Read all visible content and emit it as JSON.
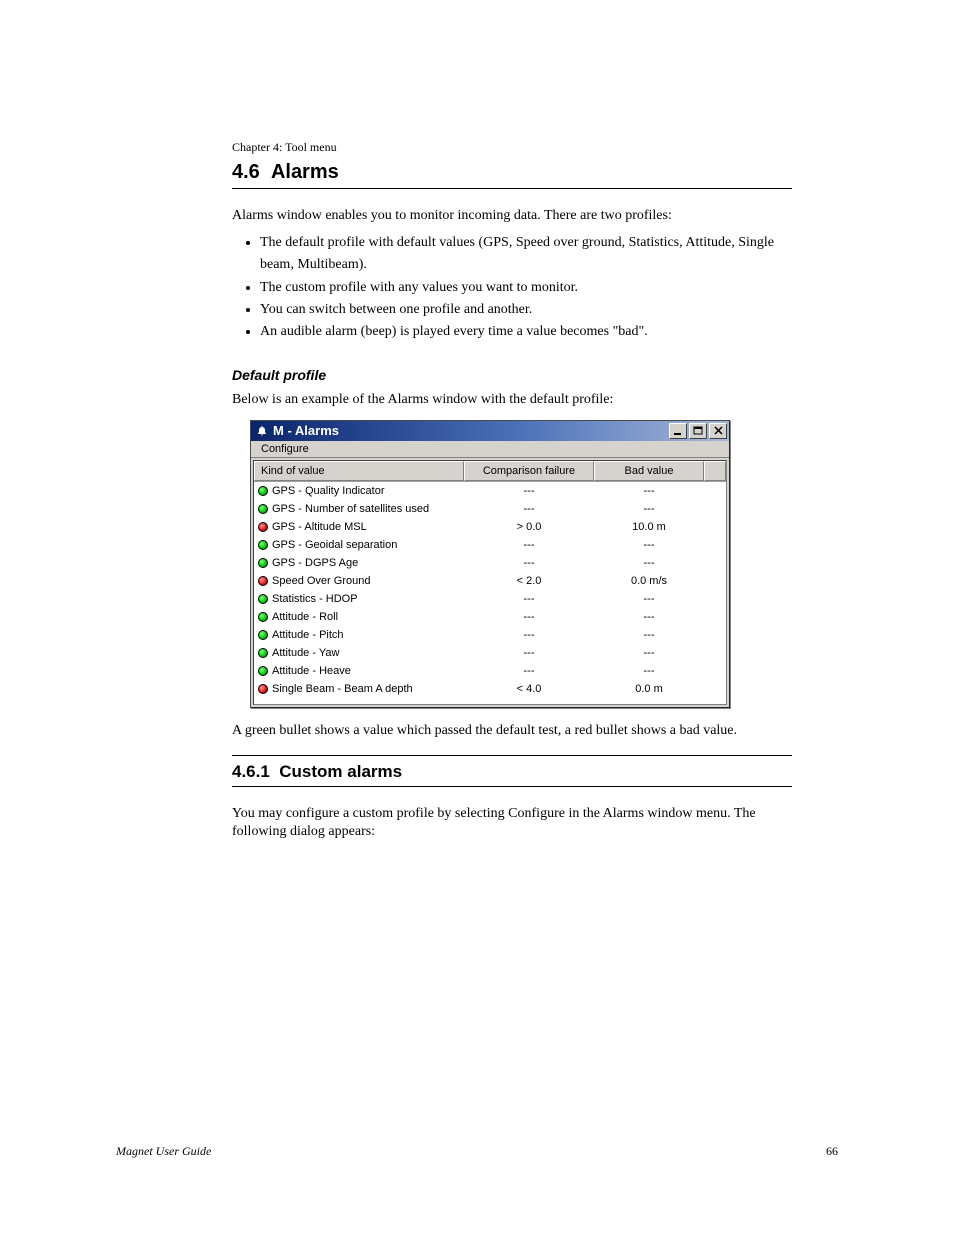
{
  "doc": {
    "chapter_label": "Chapter 4: Tool menu",
    "section_number": "4.6",
    "section_title": "Alarms",
    "intro_line1": "Alarms window enables you to monitor incoming data. There are two profiles:",
    "bullets": [
      "The default profile with default values (GPS, Speed over ground, Statistics, Attitude, Single beam, Multibeam).",
      "The custom profile with any values you want to monitor.",
      "You can switch between one profile and another.",
      "An audible alarm (beep) is played every time a value becomes \"bad\"."
    ],
    "subhead": "Default profile",
    "subhead_body": "Below is an example of the Alarms window with the default profile:",
    "after_para": "A green bullet shows a value which passed the default test, a red bullet shows a bad value.",
    "custom_section_number": "4.6.1",
    "custom_section_title": "Custom alarms",
    "custom_section_body": "You may configure a custom profile by selecting Configure in the Alarms window menu. The following dialog appears:",
    "footer_left": "Magnet User Guide",
    "footer_right": "66"
  },
  "window": {
    "title": "M - Alarms",
    "menu_configure": "Configure",
    "columns": {
      "kind": "Kind of value",
      "comparison": "Comparison failure",
      "bad": "Bad value"
    },
    "rows": [
      {
        "status": "green",
        "name": "GPS - Quality Indicator",
        "comp": "---",
        "bad": "---"
      },
      {
        "status": "green",
        "name": "GPS - Number of satellites used",
        "comp": "---",
        "bad": "---"
      },
      {
        "status": "red",
        "name": "GPS - Altitude MSL",
        "comp": "> 0.0",
        "bad": "10.0 m"
      },
      {
        "status": "green",
        "name": "GPS - Geoidal separation",
        "comp": "---",
        "bad": "---"
      },
      {
        "status": "green",
        "name": "GPS - DGPS Age",
        "comp": "---",
        "bad": "---"
      },
      {
        "status": "red",
        "name": "Speed Over Ground",
        "comp": "< 2.0",
        "bad": "0.0 m/s"
      },
      {
        "status": "green",
        "name": "Statistics - HDOP",
        "comp": "---",
        "bad": "---"
      },
      {
        "status": "green",
        "name": "Attitude - Roll",
        "comp": "---",
        "bad": "---"
      },
      {
        "status": "green",
        "name": "Attitude - Pitch",
        "comp": "---",
        "bad": "---"
      },
      {
        "status": "green",
        "name": "Attitude - Yaw",
        "comp": "---",
        "bad": "---"
      },
      {
        "status": "green",
        "name": "Attitude - Heave",
        "comp": "---",
        "bad": "---"
      },
      {
        "status": "red",
        "name": "Single Beam - Beam A depth",
        "comp": "< 4.0",
        "bad": "0.0 m"
      }
    ]
  }
}
